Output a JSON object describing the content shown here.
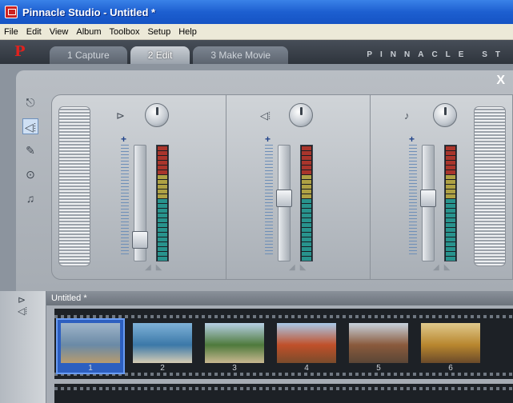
{
  "window": {
    "title": "Pinnacle Studio - Untitled *"
  },
  "menu": [
    "File",
    "Edit",
    "View",
    "Album",
    "Toolbox",
    "Setup",
    "Help"
  ],
  "tabs": [
    {
      "label": "1 Capture",
      "active": false
    },
    {
      "label": "2 Edit",
      "active": true
    },
    {
      "label": "3 Make Movie",
      "active": false
    }
  ],
  "brand": "PINNACLE ST",
  "panel": {
    "close_label": "X"
  },
  "tools": [
    {
      "name": "video-audio-tool-icon",
      "glyph": "⎋",
      "active": false
    },
    {
      "name": "volume-mixer-tool-icon",
      "glyph": "◁⦙",
      "active": true
    },
    {
      "name": "voiceover-tool-icon",
      "glyph": "✎",
      "active": false
    },
    {
      "name": "smartsound-tool-icon",
      "glyph": "⊙",
      "active": false
    },
    {
      "name": "music-tool-icon",
      "glyph": "♫",
      "active": false
    }
  ],
  "channels": [
    {
      "name": "original-audio",
      "icon": "camcorder-audio-icon",
      "glyph": "⊳",
      "level": 0.13
    },
    {
      "name": "sound-effects",
      "icon": "speaker-icon",
      "glyph": "◁⦙",
      "level": 0.55
    },
    {
      "name": "music",
      "icon": "music-note-icon",
      "glyph": "♪",
      "level": 0.55
    }
  ],
  "album": {
    "title": "Untitled *",
    "scenes": [
      {
        "number": "1",
        "selected": true
      },
      {
        "number": "2",
        "selected": false
      },
      {
        "number": "3",
        "selected": false
      },
      {
        "number": "4",
        "selected": false
      },
      {
        "number": "5",
        "selected": false
      },
      {
        "number": "6",
        "selected": false
      }
    ]
  },
  "colors": {
    "titlebar": "#1d5fd0",
    "selected_scene": "#2d5fc0",
    "meter_low": "#2aa8a0",
    "meter_mid": "#c8b84a",
    "meter_high": "#c23a2e"
  }
}
